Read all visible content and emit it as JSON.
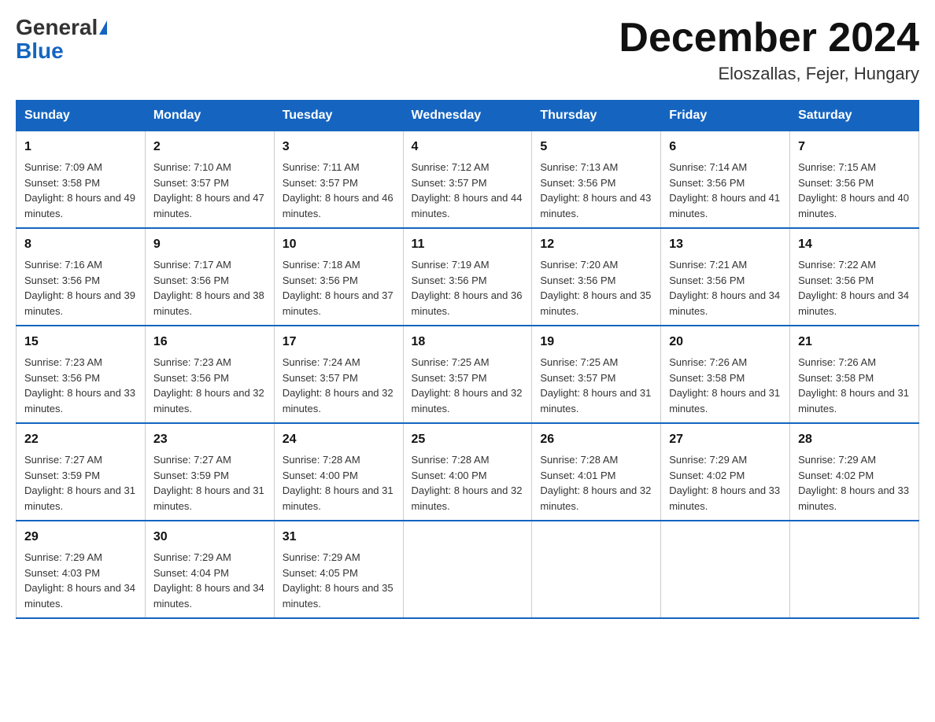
{
  "header": {
    "logo_line1": "General",
    "logo_line2": "Blue",
    "month_title": "December 2024",
    "location": "Eloszallas, Fejer, Hungary"
  },
  "calendar": {
    "days_of_week": [
      "Sunday",
      "Monday",
      "Tuesday",
      "Wednesday",
      "Thursday",
      "Friday",
      "Saturday"
    ],
    "weeks": [
      [
        {
          "day": "1",
          "sunrise": "7:09 AM",
          "sunset": "3:58 PM",
          "daylight": "8 hours and 49 minutes."
        },
        {
          "day": "2",
          "sunrise": "7:10 AM",
          "sunset": "3:57 PM",
          "daylight": "8 hours and 47 minutes."
        },
        {
          "day": "3",
          "sunrise": "7:11 AM",
          "sunset": "3:57 PM",
          "daylight": "8 hours and 46 minutes."
        },
        {
          "day": "4",
          "sunrise": "7:12 AM",
          "sunset": "3:57 PM",
          "daylight": "8 hours and 44 minutes."
        },
        {
          "day": "5",
          "sunrise": "7:13 AM",
          "sunset": "3:56 PM",
          "daylight": "8 hours and 43 minutes."
        },
        {
          "day": "6",
          "sunrise": "7:14 AM",
          "sunset": "3:56 PM",
          "daylight": "8 hours and 41 minutes."
        },
        {
          "day": "7",
          "sunrise": "7:15 AM",
          "sunset": "3:56 PM",
          "daylight": "8 hours and 40 minutes."
        }
      ],
      [
        {
          "day": "8",
          "sunrise": "7:16 AM",
          "sunset": "3:56 PM",
          "daylight": "8 hours and 39 minutes."
        },
        {
          "day": "9",
          "sunrise": "7:17 AM",
          "sunset": "3:56 PM",
          "daylight": "8 hours and 38 minutes."
        },
        {
          "day": "10",
          "sunrise": "7:18 AM",
          "sunset": "3:56 PM",
          "daylight": "8 hours and 37 minutes."
        },
        {
          "day": "11",
          "sunrise": "7:19 AM",
          "sunset": "3:56 PM",
          "daylight": "8 hours and 36 minutes."
        },
        {
          "day": "12",
          "sunrise": "7:20 AM",
          "sunset": "3:56 PM",
          "daylight": "8 hours and 35 minutes."
        },
        {
          "day": "13",
          "sunrise": "7:21 AM",
          "sunset": "3:56 PM",
          "daylight": "8 hours and 34 minutes."
        },
        {
          "day": "14",
          "sunrise": "7:22 AM",
          "sunset": "3:56 PM",
          "daylight": "8 hours and 34 minutes."
        }
      ],
      [
        {
          "day": "15",
          "sunrise": "7:23 AM",
          "sunset": "3:56 PM",
          "daylight": "8 hours and 33 minutes."
        },
        {
          "day": "16",
          "sunrise": "7:23 AM",
          "sunset": "3:56 PM",
          "daylight": "8 hours and 32 minutes."
        },
        {
          "day": "17",
          "sunrise": "7:24 AM",
          "sunset": "3:57 PM",
          "daylight": "8 hours and 32 minutes."
        },
        {
          "day": "18",
          "sunrise": "7:25 AM",
          "sunset": "3:57 PM",
          "daylight": "8 hours and 32 minutes."
        },
        {
          "day": "19",
          "sunrise": "7:25 AM",
          "sunset": "3:57 PM",
          "daylight": "8 hours and 31 minutes."
        },
        {
          "day": "20",
          "sunrise": "7:26 AM",
          "sunset": "3:58 PM",
          "daylight": "8 hours and 31 minutes."
        },
        {
          "day": "21",
          "sunrise": "7:26 AM",
          "sunset": "3:58 PM",
          "daylight": "8 hours and 31 minutes."
        }
      ],
      [
        {
          "day": "22",
          "sunrise": "7:27 AM",
          "sunset": "3:59 PM",
          "daylight": "8 hours and 31 minutes."
        },
        {
          "day": "23",
          "sunrise": "7:27 AM",
          "sunset": "3:59 PM",
          "daylight": "8 hours and 31 minutes."
        },
        {
          "day": "24",
          "sunrise": "7:28 AM",
          "sunset": "4:00 PM",
          "daylight": "8 hours and 31 minutes."
        },
        {
          "day": "25",
          "sunrise": "7:28 AM",
          "sunset": "4:00 PM",
          "daylight": "8 hours and 32 minutes."
        },
        {
          "day": "26",
          "sunrise": "7:28 AM",
          "sunset": "4:01 PM",
          "daylight": "8 hours and 32 minutes."
        },
        {
          "day": "27",
          "sunrise": "7:29 AM",
          "sunset": "4:02 PM",
          "daylight": "8 hours and 33 minutes."
        },
        {
          "day": "28",
          "sunrise": "7:29 AM",
          "sunset": "4:02 PM",
          "daylight": "8 hours and 33 minutes."
        }
      ],
      [
        {
          "day": "29",
          "sunrise": "7:29 AM",
          "sunset": "4:03 PM",
          "daylight": "8 hours and 34 minutes."
        },
        {
          "day": "30",
          "sunrise": "7:29 AM",
          "sunset": "4:04 PM",
          "daylight": "8 hours and 34 minutes."
        },
        {
          "day": "31",
          "sunrise": "7:29 AM",
          "sunset": "4:05 PM",
          "daylight": "8 hours and 35 minutes."
        },
        null,
        null,
        null,
        null
      ]
    ],
    "labels": {
      "sunrise": "Sunrise: ",
      "sunset": "Sunset: ",
      "daylight": "Daylight: "
    }
  }
}
